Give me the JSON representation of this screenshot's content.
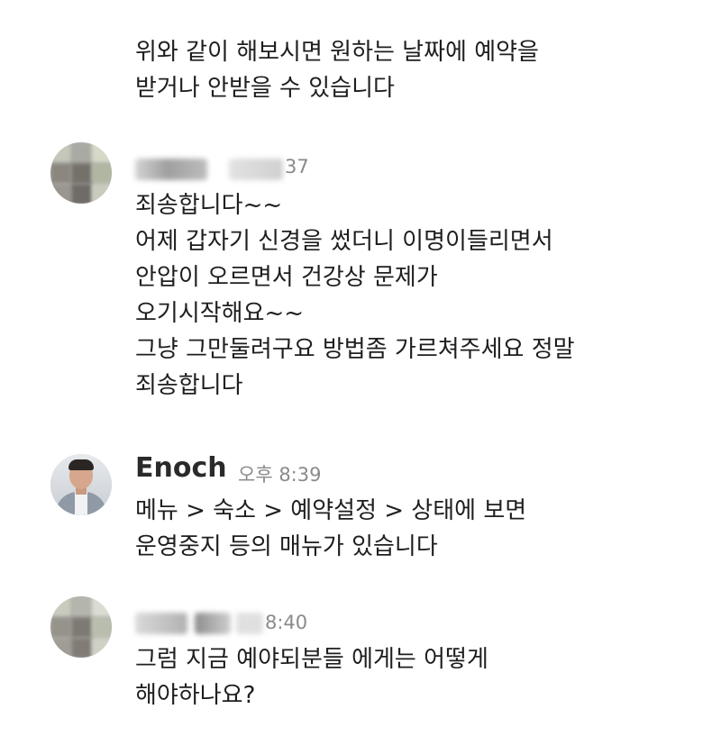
{
  "continuation": {
    "lines": [
      "위와 같이 해보시면 원하는 날짜에 예약을",
      "받거나 안받을 수 있습니다"
    ]
  },
  "messages": [
    {
      "sender_blurred": true,
      "time_fragment": "37",
      "lines": [
        "죄송합니다~~",
        "어제 갑자기 신경을 썼더니 이명이들리면서",
        "안압이 오르면서 건강상 문제가",
        "오기시작해요~~",
        "그냥 그만둘려구요 방법좀 가르쳐주세요 정말",
        "죄송합니다"
      ]
    },
    {
      "sender": "Enoch",
      "time": "오후 8:39",
      "lines": [
        "메뉴 > 숙소 > 예약설정 > 상태에 보면",
        "운영중지 등의 매뉴가 있습니다"
      ]
    },
    {
      "sender_blurred": true,
      "time_fragment": "8:40",
      "lines": [
        "그럼 지금 예야되분들 에게는 어떻게",
        "해야하나요?"
      ]
    }
  ]
}
